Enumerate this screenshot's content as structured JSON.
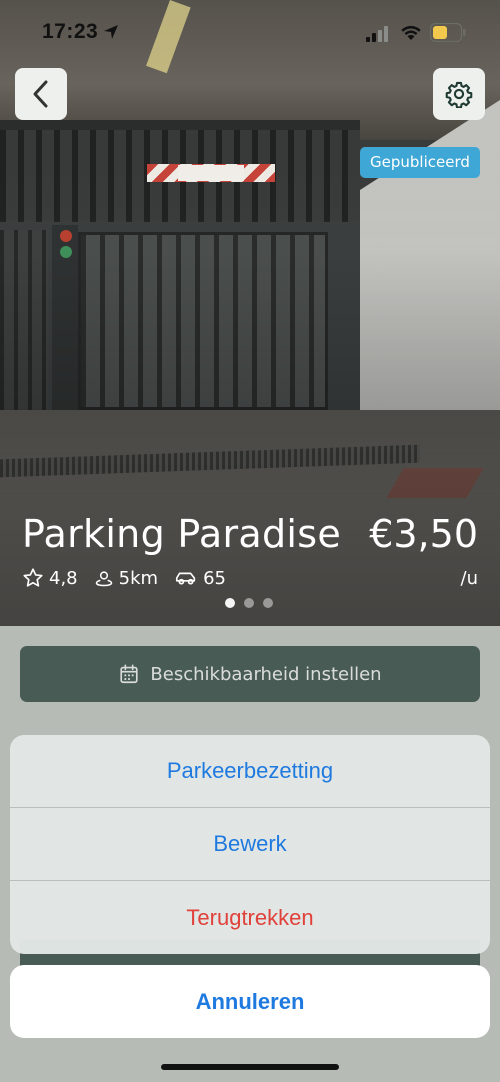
{
  "status_bar": {
    "time": "17:23",
    "icons": [
      "location-arrow-icon",
      "signal-icon",
      "wifi-icon",
      "battery-icon"
    ],
    "battery_color": "#f2c94c"
  },
  "nav": {
    "back_icon": "chevron-left-icon",
    "settings_icon": "gear-icon"
  },
  "listing": {
    "status_badge": "Gepubliceerd",
    "title": "Parking Paradise",
    "price": "€3,50",
    "price_unit": "/u",
    "rating": "4,8",
    "distance": "5km",
    "spots": "65",
    "carousel_pages": 3,
    "carousel_active_index": 0
  },
  "availability_button": {
    "label": "Beschikbaarheid instellen",
    "icon": "calendar-icon"
  },
  "action_sheet": {
    "options": [
      {
        "label": "Parkeerbezetting",
        "style": "default"
      },
      {
        "label": "Bewerk",
        "style": "default"
      },
      {
        "label": "Terugtrekken",
        "style": "destructive"
      }
    ],
    "cancel_label": "Annuleren"
  },
  "colors": {
    "primary_dark": "#1f3a33",
    "badge_blue": "#3fa7d6",
    "ios_blue": "#1f7ae0",
    "ios_red": "#e0413a"
  }
}
